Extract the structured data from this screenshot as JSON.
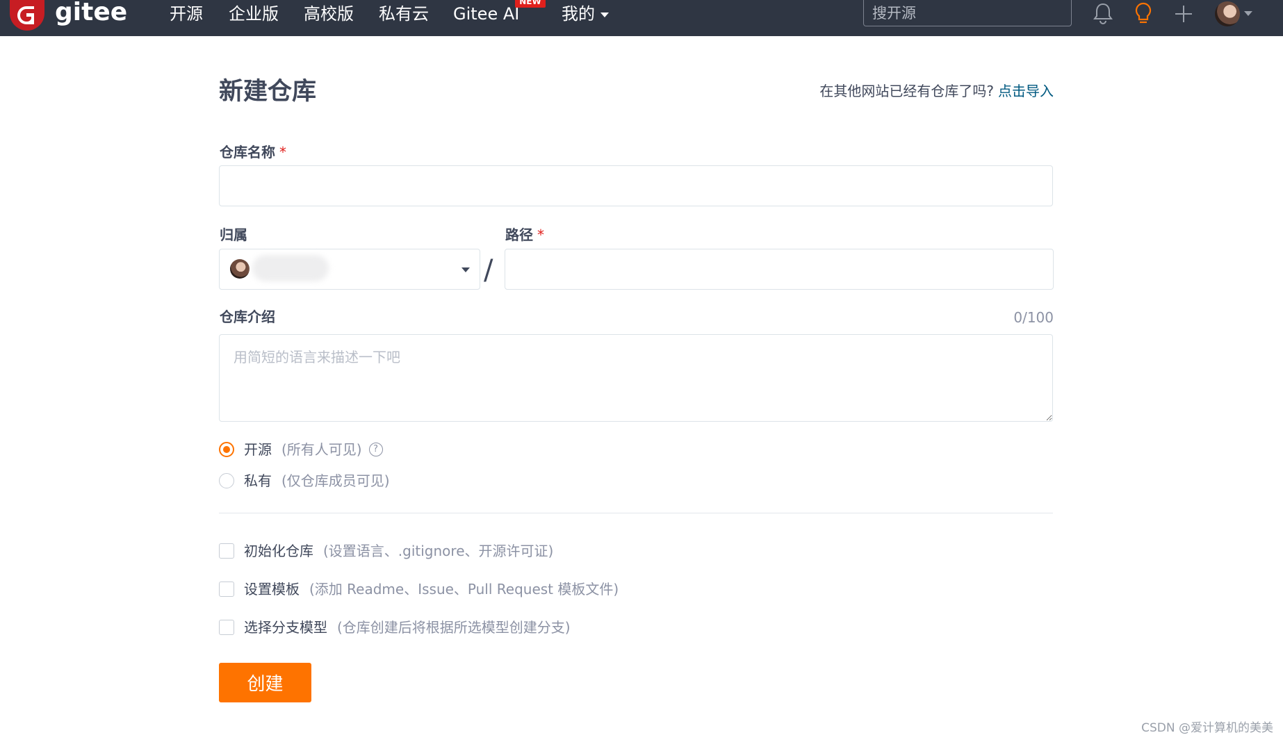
{
  "nav": {
    "logo_text": "gitee",
    "items": [
      {
        "label": "开源"
      },
      {
        "label": "企业版"
      },
      {
        "label": "高校版"
      },
      {
        "label": "私有云"
      },
      {
        "label": "Gitee AI"
      },
      {
        "label": "我的"
      }
    ],
    "badge": "NEW",
    "search_placeholder": "搜开源",
    "icons": [
      "bell-icon",
      "lightbulb-icon",
      "plus-icon",
      "avatar"
    ]
  },
  "form": {
    "title": "新建仓库",
    "import_prompt": "在其他网站已经有仓库了吗?",
    "import_link": "点击导入",
    "name_label": "仓库名称",
    "required_mark": "*",
    "name_value": "",
    "owner_label": "归属",
    "path_label": "路径",
    "path_value": "",
    "slash": "/",
    "desc_label": "仓库介绍",
    "desc_counter": "0/100",
    "desc_placeholder": "用简短的语言来描述一下吧",
    "visibility": [
      {
        "label": "开源",
        "hint": "(所有人可见)",
        "selected": true
      },
      {
        "label": "私有",
        "hint": "(仅仓库成员可见)",
        "selected": false
      }
    ],
    "help_glyph": "?",
    "options": [
      {
        "label": "初始化仓库",
        "hint": "(设置语言、.gitignore、开源许可证)",
        "checked": false
      },
      {
        "label": "设置模板",
        "hint": "(添加 Readme、Issue、Pull Request 模板文件)",
        "checked": false
      },
      {
        "label": "选择分支模型",
        "hint": "(仓库创建后将根据所选模型创建分支)",
        "checked": false
      }
    ],
    "submit_label": "创建"
  },
  "watermark": "CSDN @爱计算机的美美",
  "colors": {
    "nav_bg": "#2f3643",
    "brand_red": "#c71d23",
    "accent_orange": "#fe7300",
    "link_blue": "#005980",
    "required_red": "#e0201c"
  }
}
